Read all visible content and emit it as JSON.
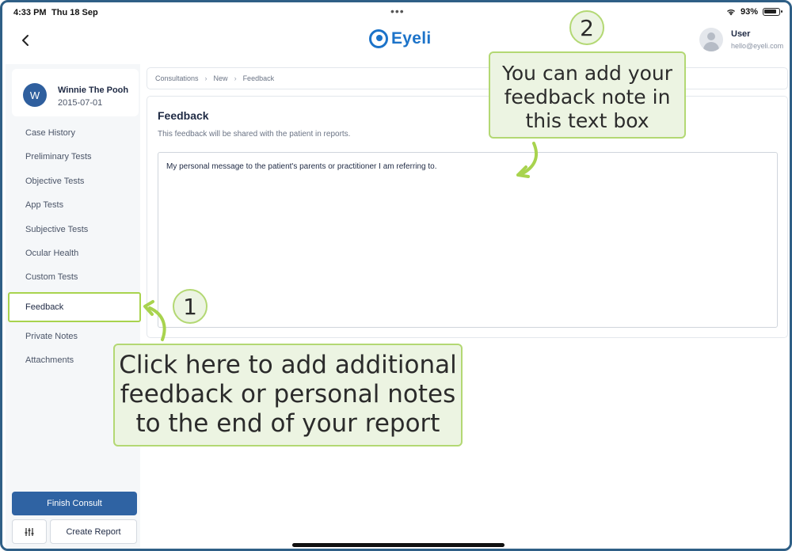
{
  "status_bar": {
    "time": "4:33 PM",
    "date": "Thu 18 Sep",
    "battery": "93%"
  },
  "header": {
    "logo_text": "Eyeli",
    "user_name": "User",
    "user_email": "hello@eyeli.com"
  },
  "patient": {
    "initial": "W",
    "name": "Winnie The Pooh",
    "dob": "2015-07-01"
  },
  "sidebar": {
    "items": [
      {
        "label": "Case History"
      },
      {
        "label": "Preliminary Tests"
      },
      {
        "label": "Objective Tests"
      },
      {
        "label": "App Tests"
      },
      {
        "label": "Subjective Tests"
      },
      {
        "label": "Ocular Health"
      },
      {
        "label": "Custom Tests"
      },
      {
        "label": "Feedback"
      },
      {
        "label": "Private Notes"
      },
      {
        "label": "Attachments"
      }
    ],
    "active_item": "Feedback",
    "finish_label": "Finish Consult",
    "create_report_label": "Create Report"
  },
  "breadcrumb": [
    "Consultations",
    "New",
    "Feedback"
  ],
  "feedback": {
    "title": "Feedback",
    "subtitle": "This feedback will be shared with the patient in reports.",
    "text": "My personal message to the patient's parents or practitioner I am referring to."
  },
  "annotations": {
    "badge_1": "1",
    "badge_2": "2",
    "callout_1": "Click here to add additional feedback or personal notes to the end of your report",
    "callout_2": "You can add your feedback note in this text box"
  },
  "colors": {
    "accent": "#2f63a3",
    "callout_fill": "#ecf4e2",
    "callout_border": "#b3d873",
    "frame": "#2f5f86"
  }
}
